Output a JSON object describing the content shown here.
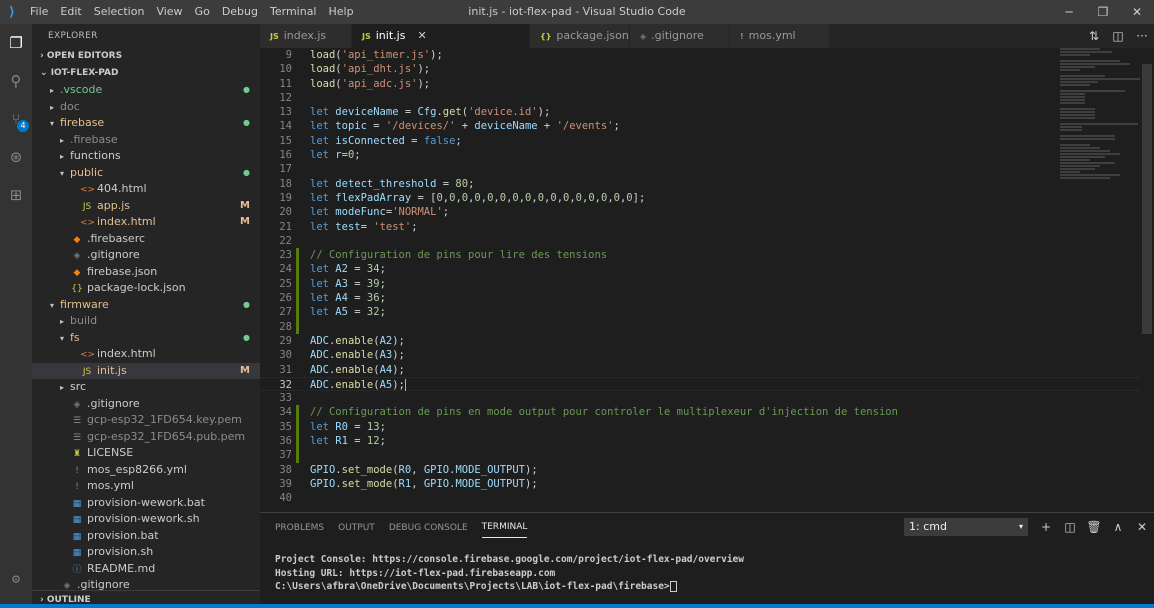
{
  "titlebar": {
    "menu": [
      "File",
      "Edit",
      "Selection",
      "View",
      "Go",
      "Debug",
      "Terminal",
      "Help"
    ],
    "window_title": "init.js - iot-flex-pad - Visual Studio Code",
    "controls": {
      "minimize": "─",
      "maximize": "❐",
      "close": "✕"
    }
  },
  "activity": {
    "items": [
      {
        "name": "explorer-icon",
        "glyph": "❐"
      },
      {
        "name": "search-icon",
        "glyph": "⚲"
      },
      {
        "name": "source-control-icon",
        "glyph": "⑂"
      },
      {
        "name": "debug-icon",
        "glyph": "⊛"
      },
      {
        "name": "extensions-icon",
        "glyph": "⊞"
      }
    ],
    "scm_badge": "4",
    "settings_glyph": "⚙"
  },
  "sidebar": {
    "title": "EXPLORER",
    "open_editors": "OPEN EDITORS",
    "root": "IOT-FLEX-PAD",
    "items": [
      {
        "label": ".vscode",
        "indent": 1,
        "twisty": "▸",
        "icon": "",
        "color": "green",
        "status": "dot"
      },
      {
        "label": "doc",
        "indent": 1,
        "twisty": "▸",
        "icon": "",
        "color": "dim",
        "status": ""
      },
      {
        "label": "firebase",
        "indent": 1,
        "twisty": "▾",
        "icon": "",
        "color": "yellow",
        "status": "dot"
      },
      {
        "label": ".firebase",
        "indent": 2,
        "twisty": "▸",
        "icon": "",
        "color": "dim",
        "status": ""
      },
      {
        "label": "functions",
        "indent": 2,
        "twisty": "▸",
        "icon": "",
        "color": "",
        "status": ""
      },
      {
        "label": "public",
        "indent": 2,
        "twisty": "▾",
        "icon": "",
        "color": "yellow",
        "status": "dot"
      },
      {
        "label": "404.html",
        "indent": 3,
        "twisty": "",
        "icon": "<>",
        "iconColor": "#e37933",
        "color": "",
        "status": ""
      },
      {
        "label": "app.js",
        "indent": 3,
        "twisty": "",
        "icon": "JS",
        "iconColor": "#cbcb41",
        "color": "yellow",
        "status": "M"
      },
      {
        "label": "index.html",
        "indent": 3,
        "twisty": "",
        "icon": "<>",
        "iconColor": "#e37933",
        "color": "yellow",
        "status": "M"
      },
      {
        "label": ".firebaserc",
        "indent": 2,
        "twisty": "",
        "icon": "◆",
        "iconColor": "#f5820d",
        "color": "",
        "status": ""
      },
      {
        "label": ".gitignore",
        "indent": 2,
        "twisty": "",
        "icon": "◈",
        "iconColor": "#6d8086",
        "color": "",
        "status": ""
      },
      {
        "label": "firebase.json",
        "indent": 2,
        "twisty": "",
        "icon": "◆",
        "iconColor": "#f5820d",
        "color": "",
        "status": ""
      },
      {
        "label": "package-lock.json",
        "indent": 2,
        "twisty": "",
        "icon": "{}",
        "iconColor": "#cbcb41",
        "color": "",
        "status": ""
      },
      {
        "label": "firmware",
        "indent": 1,
        "twisty": "▾",
        "icon": "",
        "color": "yellow",
        "status": "dot"
      },
      {
        "label": "build",
        "indent": 2,
        "twisty": "▸",
        "icon": "",
        "color": "dim",
        "status": ""
      },
      {
        "label": "fs",
        "indent": 2,
        "twisty": "▾",
        "icon": "",
        "color": "yellow",
        "status": "dot"
      },
      {
        "label": "index.html",
        "indent": 3,
        "twisty": "",
        "icon": "<>",
        "iconColor": "#e37933",
        "color": "",
        "status": ""
      },
      {
        "label": "init.js",
        "indent": 3,
        "twisty": "",
        "icon": "JS",
        "iconColor": "#cbcb41",
        "color": "yellow",
        "status": "M",
        "selected": true
      },
      {
        "label": "src",
        "indent": 2,
        "twisty": "▸",
        "icon": "",
        "color": "",
        "status": ""
      },
      {
        "label": ".gitignore",
        "indent": 2,
        "twisty": "",
        "icon": "◈",
        "iconColor": "#6d8086",
        "color": "",
        "status": ""
      },
      {
        "label": "gcp-esp32_1FD654.key.pem",
        "indent": 2,
        "twisty": "",
        "icon": "☰",
        "iconColor": "#8c8c8c",
        "color": "dim",
        "status": ""
      },
      {
        "label": "gcp-esp32_1FD654.pub.pem",
        "indent": 2,
        "twisty": "",
        "icon": "☰",
        "iconColor": "#8c8c8c",
        "color": "dim",
        "status": ""
      },
      {
        "label": "LICENSE",
        "indent": 2,
        "twisty": "",
        "icon": "♜",
        "iconColor": "#cbcb41",
        "color": "",
        "status": ""
      },
      {
        "label": "mos_esp8266.yml",
        "indent": 2,
        "twisty": "",
        "icon": "!",
        "iconColor": "#a074c4",
        "color": "",
        "status": ""
      },
      {
        "label": "mos.yml",
        "indent": 2,
        "twisty": "",
        "icon": "!",
        "iconColor": "#a074c4",
        "color": "",
        "status": ""
      },
      {
        "label": "provision-wework.bat",
        "indent": 2,
        "twisty": "",
        "icon": "▦",
        "iconColor": "#4d9fe0",
        "color": "",
        "status": ""
      },
      {
        "label": "provision-wework.sh",
        "indent": 2,
        "twisty": "",
        "icon": "▦",
        "iconColor": "#4d9fe0",
        "color": "",
        "status": ""
      },
      {
        "label": "provision.bat",
        "indent": 2,
        "twisty": "",
        "icon": "▦",
        "iconColor": "#4d9fe0",
        "color": "",
        "status": ""
      },
      {
        "label": "provision.sh",
        "indent": 2,
        "twisty": "",
        "icon": "▦",
        "iconColor": "#4d9fe0",
        "color": "",
        "status": ""
      },
      {
        "label": "README.md",
        "indent": 2,
        "twisty": "",
        "icon": "ⓘ",
        "iconColor": "#519aba",
        "color": "",
        "status": ""
      },
      {
        "label": ".gitignore",
        "indent": 1,
        "twisty": "",
        "icon": "◈",
        "iconColor": "#6d8086",
        "color": "",
        "status": ""
      }
    ],
    "outline": "OUTLINE"
  },
  "tabs": [
    {
      "label": "index.js",
      "icon": "JS",
      "iconColor": "#cbcb41",
      "active": false
    },
    {
      "label": "init.js",
      "icon": "JS",
      "iconColor": "#cbcb41",
      "active": true
    },
    {
      "label": "package.json",
      "icon": "{}",
      "iconColor": "#cbcb41",
      "active": false
    },
    {
      "label": ".gitignore",
      "icon": "◈",
      "iconColor": "#6d8086",
      "active": false
    },
    {
      "label": "mos.yml",
      "icon": "!",
      "iconColor": "#a074c4",
      "active": false
    }
  ],
  "tab_close": "✕",
  "editor_actions": [
    "⇅",
    "◫",
    "···"
  ],
  "editor": {
    "current_line": 32,
    "lines": [
      {
        "n": 9,
        "t": [
          [
            "f",
            "load"
          ],
          [
            "",
            "("
          ],
          [
            "s",
            "'api_timer.js'"
          ],
          [
            "",
            ");"
          ]
        ]
      },
      {
        "n": 10,
        "t": [
          [
            "f",
            "load"
          ],
          [
            "",
            "("
          ],
          [
            "s",
            "'api_dht.js'"
          ],
          [
            "",
            ");"
          ]
        ]
      },
      {
        "n": 11,
        "t": [
          [
            "f",
            "load"
          ],
          [
            "",
            "("
          ],
          [
            "s",
            "'api_adc.js'"
          ],
          [
            "",
            ");"
          ]
        ]
      },
      {
        "n": 12,
        "t": []
      },
      {
        "n": 13,
        "t": [
          [
            "k",
            "let "
          ],
          [
            "v",
            "deviceName"
          ],
          [
            "",
            " = "
          ],
          [
            "v",
            "Cfg"
          ],
          [
            "",
            "."
          ],
          [
            "f",
            "get"
          ],
          [
            "",
            "("
          ],
          [
            "s",
            "'device.id'"
          ],
          [
            "",
            ");"
          ]
        ]
      },
      {
        "n": 14,
        "t": [
          [
            "k",
            "let "
          ],
          [
            "v",
            "topic"
          ],
          [
            "",
            " = "
          ],
          [
            "s",
            "'/devices/'"
          ],
          [
            "",
            " + "
          ],
          [
            "v",
            "deviceName"
          ],
          [
            "",
            " + "
          ],
          [
            "s",
            "'/events'"
          ],
          [
            "",
            ";"
          ]
        ]
      },
      {
        "n": 15,
        "t": [
          [
            "k",
            "let "
          ],
          [
            "v",
            "isConnected"
          ],
          [
            "",
            " = "
          ],
          [
            "k",
            "false"
          ],
          [
            "",
            ";"
          ]
        ]
      },
      {
        "n": 16,
        "t": [
          [
            "k",
            "let "
          ],
          [
            "v",
            "r"
          ],
          [
            "",
            "="
          ],
          [
            "n",
            "0"
          ],
          [
            "",
            ";"
          ]
        ]
      },
      {
        "n": 17,
        "t": []
      },
      {
        "n": 18,
        "t": [
          [
            "k",
            "let "
          ],
          [
            "v",
            "detect_threshold"
          ],
          [
            "",
            " = "
          ],
          [
            "n",
            "80"
          ],
          [
            "",
            ";"
          ]
        ]
      },
      {
        "n": 19,
        "t": [
          [
            "k",
            "let "
          ],
          [
            "v",
            "flexPadArray"
          ],
          [
            "",
            " = ["
          ],
          [
            "n",
            "0"
          ],
          [
            "",
            ","
          ],
          [
            "n",
            "0"
          ],
          [
            "",
            ","
          ],
          [
            "n",
            "0"
          ],
          [
            "",
            ","
          ],
          [
            "n",
            "0"
          ],
          [
            "",
            ","
          ],
          [
            "n",
            "0"
          ],
          [
            "",
            ","
          ],
          [
            "n",
            "0"
          ],
          [
            "",
            ","
          ],
          [
            "n",
            "0"
          ],
          [
            "",
            ","
          ],
          [
            "n",
            "0"
          ],
          [
            "",
            ","
          ],
          [
            "n",
            "0"
          ],
          [
            "",
            ","
          ],
          [
            "n",
            "0"
          ],
          [
            "",
            ","
          ],
          [
            "n",
            "0"
          ],
          [
            "",
            ","
          ],
          [
            "n",
            "0"
          ],
          [
            "",
            ","
          ],
          [
            "n",
            "0"
          ],
          [
            "",
            ","
          ],
          [
            "n",
            "0"
          ],
          [
            "",
            ","
          ],
          [
            "n",
            "0"
          ],
          [
            "",
            ","
          ],
          [
            "n",
            "0"
          ],
          [
            "",
            "];"
          ]
        ]
      },
      {
        "n": 20,
        "t": [
          [
            "k",
            "let "
          ],
          [
            "v",
            "modeFunc"
          ],
          [
            "",
            "="
          ],
          [
            "s",
            "'NORMAL'"
          ],
          [
            "",
            ";"
          ]
        ]
      },
      {
        "n": 21,
        "t": [
          [
            "k",
            "let "
          ],
          [
            "v",
            "test"
          ],
          [
            "",
            "= "
          ],
          [
            "s",
            "'test'"
          ],
          [
            "",
            ";"
          ]
        ]
      },
      {
        "n": 22,
        "t": []
      },
      {
        "n": 23,
        "t": [
          [
            "c",
            "// Configuration de pins pour lire des tensions"
          ]
        ],
        "gm": true
      },
      {
        "n": 24,
        "t": [
          [
            "k",
            "let "
          ],
          [
            "v",
            "A2"
          ],
          [
            "",
            " = "
          ],
          [
            "n",
            "34"
          ],
          [
            "",
            ";"
          ]
        ],
        "gm": true
      },
      {
        "n": 25,
        "t": [
          [
            "k",
            "let "
          ],
          [
            "v",
            "A3"
          ],
          [
            "",
            " = "
          ],
          [
            "n",
            "39"
          ],
          [
            "",
            ";"
          ]
        ],
        "gm": true
      },
      {
        "n": 26,
        "t": [
          [
            "k",
            "let "
          ],
          [
            "v",
            "A4"
          ],
          [
            "",
            " = "
          ],
          [
            "n",
            "36"
          ],
          [
            "",
            ";"
          ]
        ],
        "gm": true
      },
      {
        "n": 27,
        "t": [
          [
            "k",
            "let "
          ],
          [
            "v",
            "A5"
          ],
          [
            "",
            " = "
          ],
          [
            "n",
            "32"
          ],
          [
            "",
            ";"
          ]
        ],
        "gm": true
      },
      {
        "n": 28,
        "t": [],
        "gm": true
      },
      {
        "n": 29,
        "t": [
          [
            "v",
            "ADC"
          ],
          [
            "",
            "."
          ],
          [
            "f",
            "enable"
          ],
          [
            "",
            "("
          ],
          [
            "v",
            "A2"
          ],
          [
            "",
            ");"
          ]
        ]
      },
      {
        "n": 30,
        "t": [
          [
            "v",
            "ADC"
          ],
          [
            "",
            "."
          ],
          [
            "f",
            "enable"
          ],
          [
            "",
            "("
          ],
          [
            "v",
            "A3"
          ],
          [
            "",
            ");"
          ]
        ]
      },
      {
        "n": 31,
        "t": [
          [
            "v",
            "ADC"
          ],
          [
            "",
            "."
          ],
          [
            "f",
            "enable"
          ],
          [
            "",
            "("
          ],
          [
            "v",
            "A4"
          ],
          [
            "",
            ");"
          ]
        ]
      },
      {
        "n": 32,
        "t": [
          [
            "v",
            "ADC"
          ],
          [
            "",
            "."
          ],
          [
            "f",
            "enable"
          ],
          [
            "",
            "("
          ],
          [
            "v",
            "A5"
          ],
          [
            "",
            ");"
          ]
        ],
        "caret": true
      },
      {
        "n": 33,
        "t": []
      },
      {
        "n": 34,
        "t": [
          [
            "c",
            "// Configuration de pins en mode output pour controler le multiplexeur d'injection de tension"
          ]
        ],
        "gm": true
      },
      {
        "n": 35,
        "t": [
          [
            "k",
            "let "
          ],
          [
            "v",
            "R0"
          ],
          [
            "",
            " = "
          ],
          [
            "n",
            "13"
          ],
          [
            "",
            ";"
          ]
        ],
        "gm": true
      },
      {
        "n": 36,
        "t": [
          [
            "k",
            "let "
          ],
          [
            "v",
            "R1"
          ],
          [
            "",
            " = "
          ],
          [
            "n",
            "12"
          ],
          [
            "",
            ";"
          ]
        ],
        "gm": true
      },
      {
        "n": 37,
        "t": [],
        "gm": true
      },
      {
        "n": 38,
        "t": [
          [
            "v",
            "GPIO"
          ],
          [
            "",
            "."
          ],
          [
            "f",
            "set_mode"
          ],
          [
            "",
            "("
          ],
          [
            "v",
            "R0"
          ],
          [
            "",
            ", "
          ],
          [
            "v",
            "GPIO"
          ],
          [
            "",
            "."
          ],
          [
            "v",
            "MODE_OUTPUT"
          ],
          [
            "",
            ");"
          ]
        ]
      },
      {
        "n": 39,
        "t": [
          [
            "v",
            "GPIO"
          ],
          [
            "",
            "."
          ],
          [
            "f",
            "set_mode"
          ],
          [
            "",
            "("
          ],
          [
            "v",
            "R1"
          ],
          [
            "",
            ", "
          ],
          [
            "v",
            "GPIO"
          ],
          [
            "",
            "."
          ],
          [
            "v",
            "MODE_OUTPUT"
          ],
          [
            "",
            ");"
          ]
        ]
      },
      {
        "n": 40,
        "t": []
      }
    ]
  },
  "panel": {
    "tabs": [
      "PROBLEMS",
      "OUTPUT",
      "DEBUG CONSOLE",
      "TERMINAL"
    ],
    "active_tab": "TERMINAL",
    "terminal_select": "1: cmd",
    "actions": [
      "+",
      "◫",
      "🗑",
      "∧",
      "✕"
    ],
    "terminal_lines": [
      "Project Console: https://console.firebase.google.com/project/iot-flex-pad/overview",
      "Hosting URL: https://iot-flex-pad.firebaseapp.com"
    ],
    "prompt": "C:\\Users\\afbra\\OneDrive\\Documents\\Projects\\LAB\\iot-flex-pad\\firebase>"
  }
}
